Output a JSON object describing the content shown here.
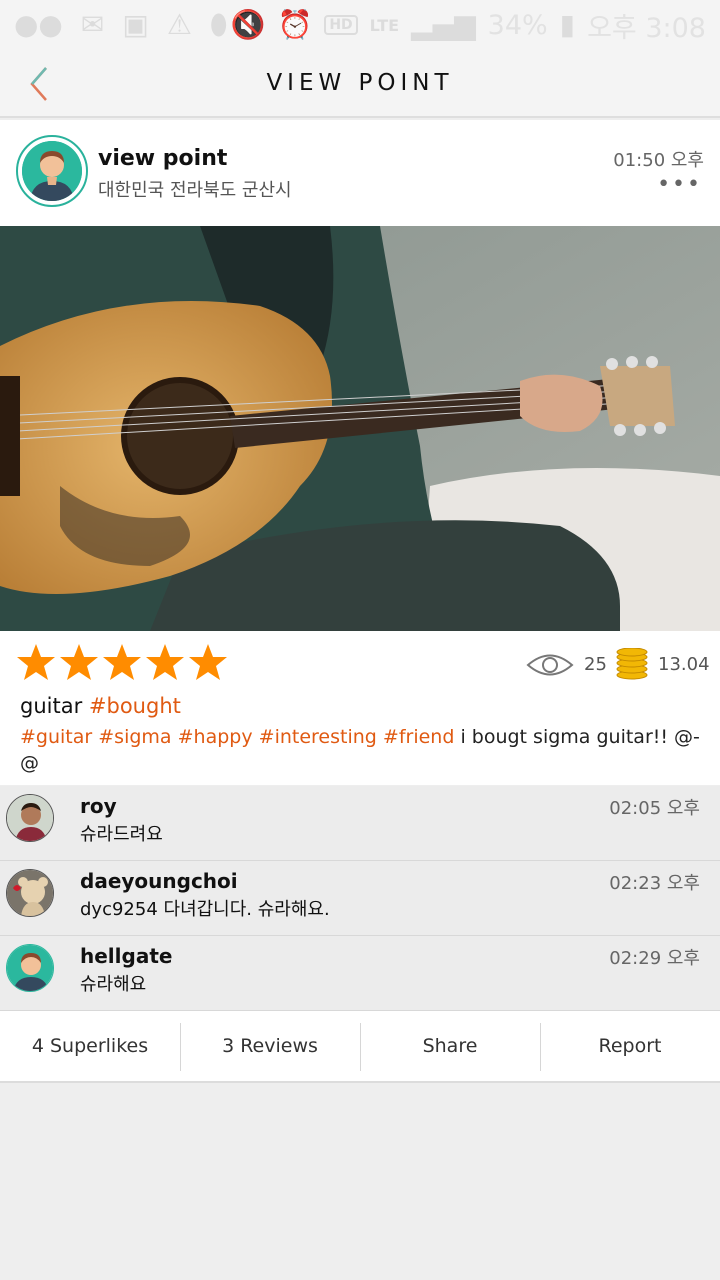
{
  "status_bar": {
    "battery": "34%",
    "time": "오후 3:08",
    "network": "LTE",
    "hd_label": "HD",
    "volte": "Voice"
  },
  "header": {
    "title": "VIEW POINT"
  },
  "post": {
    "username": "view point",
    "location": "대한민국 전라북도 군산시",
    "time": "01:50 오후",
    "rating": 5,
    "views": "25",
    "coins": "13.04",
    "caption_plain": "guitar",
    "caption_tag": "#bought",
    "tags": [
      "#guitar",
      "#sigma",
      "#happy",
      "#interesting",
      "#friend"
    ],
    "body_text": "i bougt sigma guitar!! @-@"
  },
  "comments": [
    {
      "username": "roy",
      "text": "슈라드려요",
      "time": "02:05 오후"
    },
    {
      "username": "daeyoungchoi",
      "text": "dyc9254 다녀갑니다. 슈라해요.",
      "time": "02:23 오후"
    },
    {
      "username": "hellgate",
      "text": "슈라해요",
      "time": "02:29 오후"
    }
  ],
  "actions": {
    "superlikes": "4 Superlikes",
    "reviews": "3 Reviews",
    "share": "Share",
    "report": "Report"
  },
  "colors": {
    "accent": "#e05a12",
    "star": "#ff8c00",
    "avatar_teal": "#2bb89e"
  }
}
